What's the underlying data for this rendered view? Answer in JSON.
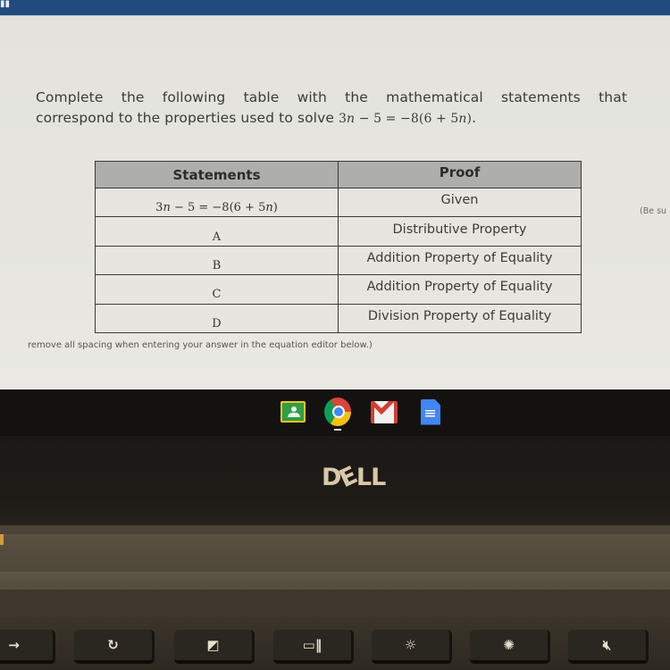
{
  "screen": {
    "topbar_color": "#214a7d",
    "question": {
      "line1": "Complete the following table with the mathematical statements that",
      "line2_prefix": "correspond to the properties used to solve ",
      "equation": "3n − 5 = −8(6 + 5n)",
      "line2_suffix": "."
    },
    "table": {
      "headers": [
        "Statements",
        "Proof"
      ],
      "rows": [
        {
          "statement": "3n − 5 = −8(6 + 5n)",
          "proof": "Given"
        },
        {
          "statement": "A",
          "proof": "Distributive Property"
        },
        {
          "statement": "B",
          "proof": "Addition Property of Equality"
        },
        {
          "statement": "C",
          "proof": "Addition Property of Equality"
        },
        {
          "statement": "D",
          "proof": "Division Property of Equality"
        }
      ]
    },
    "side_note": "(Be su",
    "bottom_note": "remove all spacing when entering your answer in the equation editor below.)"
  },
  "shelf": {
    "apps": [
      {
        "name": "Google Classroom",
        "icon": "classroom-icon"
      },
      {
        "name": "Google Chrome",
        "icon": "chrome-icon",
        "running": true
      },
      {
        "name": "Gmail",
        "icon": "gmail-icon"
      },
      {
        "name": "Google Docs",
        "icon": "docs-icon"
      }
    ]
  },
  "laptop": {
    "brand": "DELL",
    "keys": [
      {
        "name": "forward",
        "glyph": "→"
      },
      {
        "name": "refresh",
        "glyph": "↻"
      },
      {
        "name": "fullscreen",
        "glyph": "◩"
      },
      {
        "name": "overview",
        "glyph": "▭‖"
      },
      {
        "name": "brightness-down",
        "glyph": "☼"
      },
      {
        "name": "brightness-up",
        "glyph": "✺"
      },
      {
        "name": "mute",
        "glyph": "🔇︎"
      }
    ]
  }
}
